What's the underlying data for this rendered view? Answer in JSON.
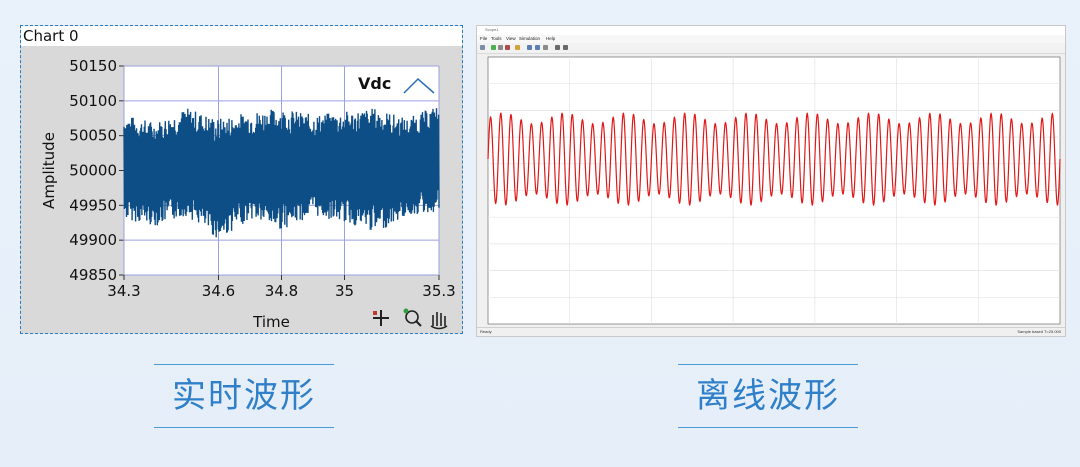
{
  "left_chart": {
    "window_title": "Chart 0",
    "legend_label": "Vdc",
    "x_label": "Time",
    "y_label": "Amplitude",
    "x_ticks": [
      "34.3",
      "34.6",
      "34.8",
      "35",
      "35.3"
    ],
    "y_ticks": [
      "50150",
      "50100",
      "50050",
      "50000",
      "49950",
      "49900",
      "49850"
    ],
    "tools": [
      "cursor-move-icon",
      "zoom-icon",
      "pan-hand-icon"
    ],
    "colors": {
      "trace": "#0e4e86",
      "plot_bg": "#ffffff",
      "grid": "#9aa0e0",
      "frame": "#d9d9d9"
    }
  },
  "right_scope": {
    "window_title": "Scope1",
    "menu": [
      "File",
      "Tools",
      "View",
      "Simulation",
      "Help"
    ],
    "status_left": "Ready",
    "status_right": "Sample based  T=25.000",
    "trace_color": "#e01818"
  },
  "captions": {
    "left": "实时波形",
    "right": "离线波形"
  },
  "chart_data": [
    {
      "type": "line",
      "title": "",
      "xlabel": "Time",
      "ylabel": "Amplitude",
      "xlim": [
        34.3,
        35.3
      ],
      "ylim": [
        49850,
        50150
      ],
      "legend": "top-right",
      "grid": true,
      "series": [
        {
          "name": "Vdc",
          "description_values": "dense noisy oscillation",
          "x": [
            34.3,
            34.4,
            34.5,
            34.6,
            34.7,
            34.8,
            34.9,
            35.0,
            35.1,
            35.2,
            35.3
          ],
          "y_min": [
            49930,
            49920,
            49935,
            49900,
            49930,
            49915,
            49935,
            49925,
            49910,
            49935,
            49940
          ],
          "y_max": [
            50080,
            50070,
            50090,
            50075,
            50085,
            50090,
            50080,
            50085,
            50090,
            50075,
            50095
          ]
        }
      ]
    },
    {
      "type": "line",
      "title": "",
      "grid": true,
      "series": [
        {
          "name": "",
          "x_range": [
            0,
            1
          ],
          "cycles": 56,
          "y_min": -1,
          "y_max": 1
        }
      ]
    }
  ]
}
